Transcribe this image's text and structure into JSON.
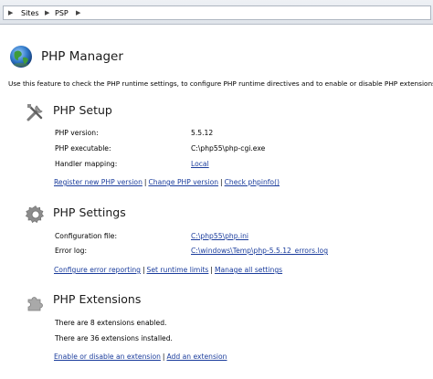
{
  "breadcrumb": {
    "items": [
      "Sites",
      "PSP"
    ]
  },
  "header": {
    "title": "PHP Manager",
    "description": "Use this feature to check the PHP runtime settings, to configure PHP runtime directives and to enable or disable PHP extensions."
  },
  "setup": {
    "title": "PHP Setup",
    "rows": [
      {
        "label": "PHP version:",
        "value": "5.5.12"
      },
      {
        "label": "PHP executable:",
        "value": "C:\\php55\\php-cgi.exe"
      },
      {
        "label": "Handler mapping:",
        "value": "Local"
      }
    ],
    "actions": [
      "Register new PHP version",
      "Change PHP version",
      "Check phpinfo()"
    ]
  },
  "settings": {
    "title": "PHP Settings",
    "rows": [
      {
        "label": "Configuration file:",
        "value": "C:\\php55\\php.ini"
      },
      {
        "label": "Error log:",
        "value": "C:\\windows\\Temp\\php-5.5.12_errors.log"
      }
    ],
    "actions": [
      "Configure error reporting",
      "Set runtime limits",
      "Manage all settings"
    ]
  },
  "extensions": {
    "title": "PHP Extensions",
    "enabled_text": "There are 8 extensions enabled.",
    "installed_text": "There are 36 extensions installed.",
    "actions": [
      "Enable or disable an extension",
      "Add an extension"
    ]
  },
  "colors": {
    "link": "#1a3c9c",
    "background": "#ffffff"
  },
  "icons": [
    "chevron-right-icon",
    "globe-icon",
    "tools-icon",
    "gear-icon",
    "puzzle-icon"
  ]
}
